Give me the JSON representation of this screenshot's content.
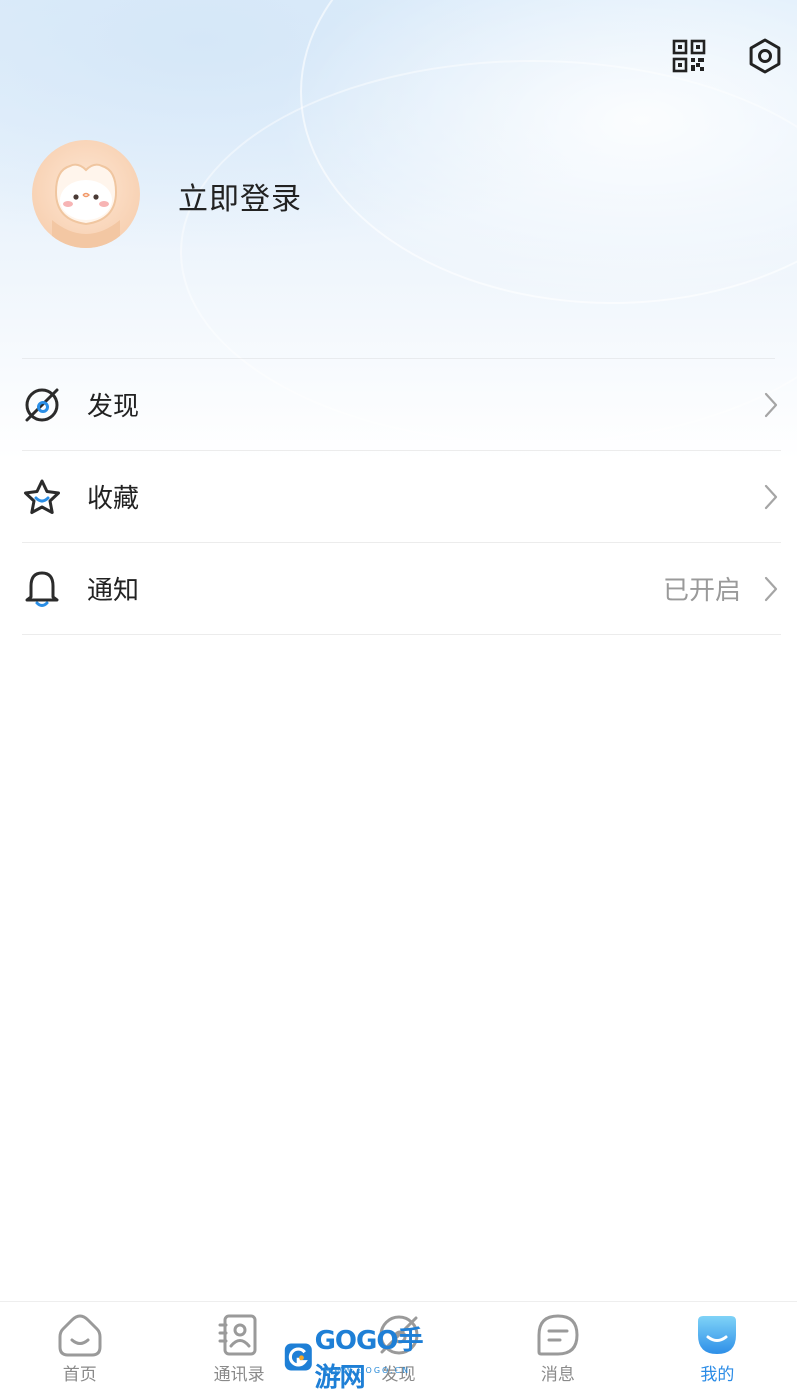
{
  "header": {
    "login_text": "立即登录",
    "qr_icon": "qr-code-icon",
    "settings_icon": "gear-icon"
  },
  "menu": {
    "items": [
      {
        "label": "发现",
        "icon": "compass-icon",
        "value": ""
      },
      {
        "label": "收藏",
        "icon": "star-icon",
        "value": ""
      },
      {
        "label": "通知",
        "icon": "bell-icon",
        "value": "已开启"
      }
    ]
  },
  "tabbar": {
    "items": [
      {
        "label": "首页",
        "icon": "home-icon",
        "active": false
      },
      {
        "label": "通讯录",
        "icon": "contacts-icon",
        "active": false
      },
      {
        "label": "发现",
        "icon": "compass-icon",
        "active": false
      },
      {
        "label": "消息",
        "icon": "message-icon",
        "active": false
      },
      {
        "label": "我的",
        "icon": "profile-icon",
        "active": true
      }
    ]
  },
  "watermark": {
    "text": "GOGO手游网",
    "sub": "WWW.GOGO.CN"
  },
  "colors": {
    "accent": "#2c8ce6",
    "text": "#222222",
    "muted": "#9a9a9a"
  }
}
